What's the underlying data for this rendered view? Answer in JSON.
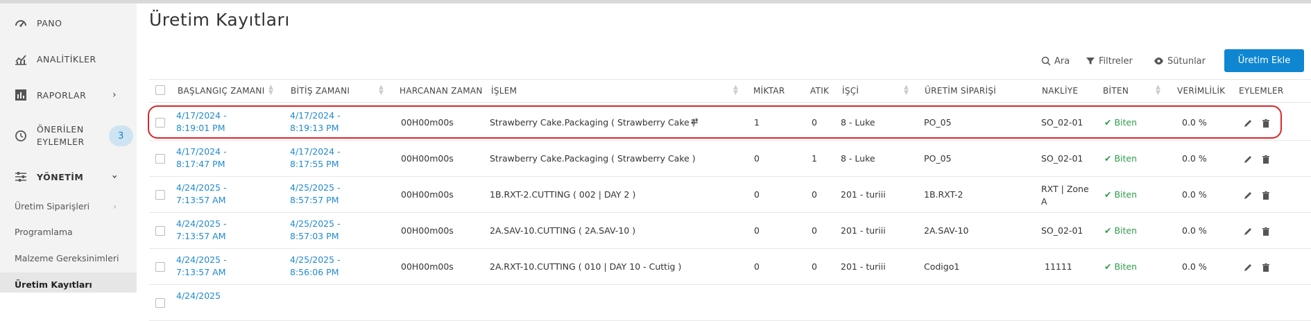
{
  "sidebar": {
    "items": [
      {
        "label": "PANO",
        "icon": "dashboard-icon"
      },
      {
        "label": "ANALİTİKLER",
        "icon": "analytics-icon"
      },
      {
        "label": "RAPORLAR",
        "icon": "reports-icon"
      },
      {
        "label_line1": "ÖNERİLEN",
        "label_line2": "EYLEMLER",
        "icon": "history-icon",
        "badge": "3"
      },
      {
        "label": "YÖNETİM",
        "icon": "sliders-icon"
      }
    ],
    "sub_items": [
      "Üretim Siparişleri",
      "Programlama",
      "Malzeme Gereksinimleri",
      "Üretim Kayıtları"
    ]
  },
  "page": {
    "title": "Üretim Kayıtları"
  },
  "toolbar": {
    "search_label": "Ara",
    "filters_label": "Filtreler",
    "columns_label": "Sütunlar",
    "add_label": "Üretim Ekle"
  },
  "table": {
    "headers": [
      "BAŞLANGIÇ ZAMANI",
      "BİTİŞ ZAMANI",
      "HARCANAN ZAMAN",
      "İŞLEM",
      "MİKTAR",
      "ATIK",
      "İŞÇİ",
      "ÜRETİM SİPARİŞİ",
      "NAKLİYE",
      "BİTEN",
      "VERİMLİLİK",
      "EYLEMLER"
    ],
    "rows": [
      {
        "start": "4/17/2024 - 8:19:01 PM",
        "end": "4/17/2024 - 8:19:13 PM",
        "elapsed": "00H00m00s",
        "process": "Strawberry Cake.Packaging ( Strawberry Cake )",
        "qty": "1",
        "waste": "0",
        "worker": "8 - Luke",
        "order": "PO_05",
        "shipping": "SO_02-01",
        "status": "Biten",
        "efficiency": "0.0 %"
      },
      {
        "start": "4/17/2024 - 8:17:47 PM",
        "end": "4/17/2024 - 8:17:55 PM",
        "elapsed": "00H00m00s",
        "process": "Strawberry Cake.Packaging ( Strawberry Cake )",
        "qty": "0",
        "waste": "1",
        "worker": "8 - Luke",
        "order": "PO_05",
        "shipping": "SO_02-01",
        "status": "Biten",
        "efficiency": "0.0 %"
      },
      {
        "start": "4/24/2025 - 7:13:57 AM",
        "end": "4/25/2025 - 8:57:57 PM",
        "elapsed": "00H00m00s",
        "process": "1B.RXT-2.CUTTING ( 002 | DAY 2 )",
        "qty": "0",
        "waste": "0",
        "worker": "201 - turiii",
        "order": "1B.RXT-2",
        "shipping": "RXT | Zone A",
        "status": "Biten",
        "efficiency": "0.0 %"
      },
      {
        "start": "4/24/2025 - 7:13:57 AM",
        "end": "4/25/2025 - 8:57:03 PM",
        "elapsed": "00H00m00s",
        "process": "2A.SAV-10.CUTTING ( 2A.SAV-10 )",
        "qty": "0",
        "waste": "0",
        "worker": "201 - turiii",
        "order": "2A.SAV-10",
        "shipping": "SO_02-01",
        "status": "Biten",
        "efficiency": "0.0 %"
      },
      {
        "start": "4/24/2025 - 7:13:57 AM",
        "end": "4/25/2025 - 8:56:06 PM",
        "elapsed": "00H00m00s",
        "process": "2A.RXT-10.CUTTING ( 010 | DAY 10 - Cuttig )",
        "qty": "0",
        "waste": "0",
        "worker": "201 - turiii",
        "order": "Codigo1",
        "shipping": "11111",
        "status": "Biten",
        "efficiency": "0.0 %"
      },
      {
        "start": "4/24/2025",
        "end": "",
        "elapsed": "",
        "process": "",
        "qty": "",
        "waste": "",
        "worker": "",
        "order": "",
        "shipping": "",
        "status": "",
        "efficiency": ""
      }
    ]
  },
  "colors": {
    "accent": "#0f86d1",
    "link": "#1f8ad0",
    "success": "#2e9c4a",
    "highlight": "#d9262b"
  }
}
